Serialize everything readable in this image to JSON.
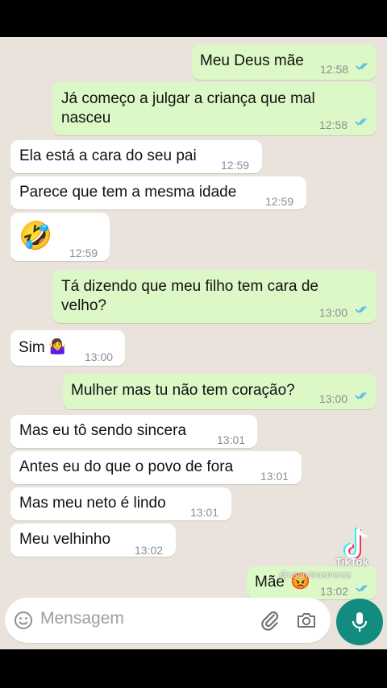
{
  "messages": [
    {
      "text": "Meu Deus mãe",
      "time": "12:58"
    },
    {
      "text_line1": "Já começo a julgar a criança que mal",
      "text_line2": "nasceu",
      "time": "12:58"
    },
    {
      "text": "Ela está a cara do seu pai",
      "time": "12:59"
    },
    {
      "text": "Parece que tem a mesma idade",
      "time": "12:59"
    },
    {
      "emoji": "🤣",
      "time": "12:59"
    },
    {
      "text_line1": "Tá dizendo que meu filho tem cara de",
      "text_line2": "velho?",
      "time": "13:00"
    },
    {
      "text": "Sim",
      "emoji": "🤷‍♀️",
      "time": "13:00"
    },
    {
      "text": "Mulher mas tu não tem coração?",
      "time": "13:00"
    },
    {
      "text": "Mas eu tô sendo sincera",
      "time": "13:01"
    },
    {
      "text": "Antes eu do que o povo de fora",
      "time": "13:01"
    },
    {
      "text": "Mas meu neto é lindo",
      "time": "13:01"
    },
    {
      "text": "Meu velhinho",
      "time": "13:02"
    },
    {
      "text": "Mãe",
      "emoji": "😡",
      "time": "13:02"
    }
  ],
  "input": {
    "placeholder": "Mensagem"
  },
  "watermark": {
    "app": "TikTok",
    "user": "@usandoasmeras"
  },
  "colors": {
    "outgoing": "#dcf8c6",
    "incoming": "#ffffff",
    "read_ticks": "#4fb6ec",
    "accent": "#128c7e",
    "background": "#e9e3db"
  },
  "icons": [
    "emoji-icon",
    "attach-icon",
    "camera-icon",
    "mic-icon",
    "read-ticks-icon",
    "tiktok-logo"
  ]
}
